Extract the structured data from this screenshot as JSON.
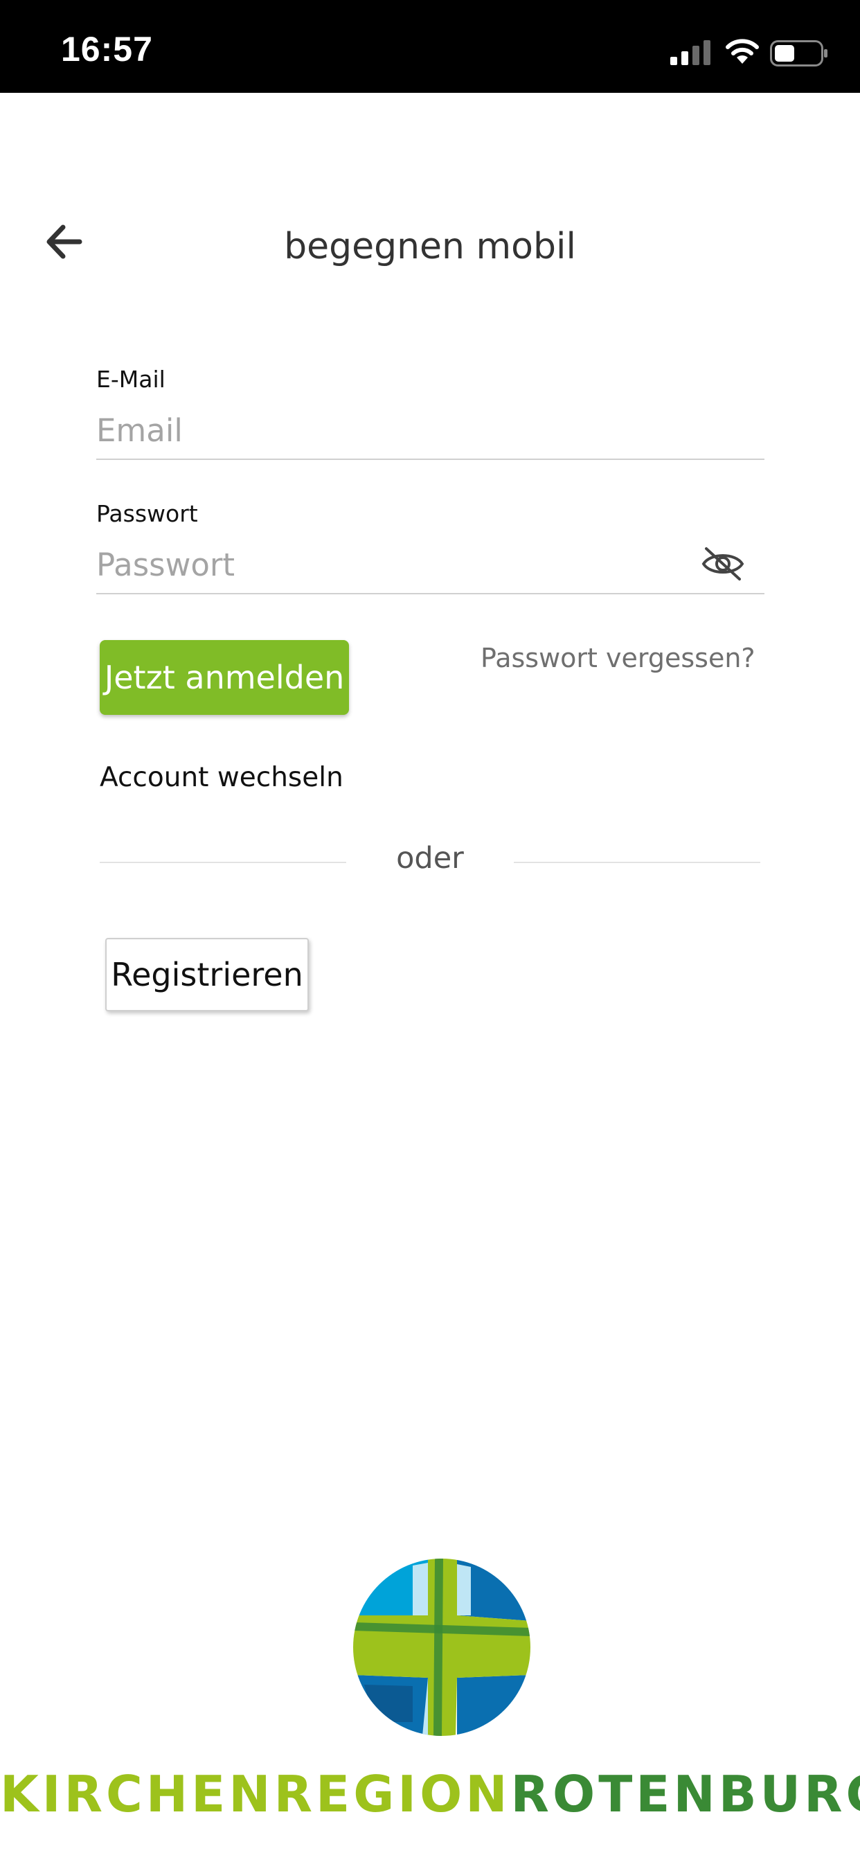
{
  "status_bar": {
    "time": "16:57",
    "icons": [
      "signal-icon",
      "wifi-icon",
      "battery-icon"
    ]
  },
  "header": {
    "back_icon": "arrow-left-icon",
    "title": "begegnen mobil"
  },
  "form": {
    "email": {
      "label": "E-Mail",
      "placeholder": "Email",
      "value": ""
    },
    "password": {
      "label": "Passwort",
      "placeholder": "Passwort",
      "value": "",
      "toggle_icon": "eye-off-icon"
    },
    "login_button": "Jetzt anmelden",
    "forgot_password": "Passwort vergessen?",
    "switch_account": "Account wechseln",
    "divider_text": "oder",
    "register_button": "Registrieren"
  },
  "logo": {
    "wordmark_part1": "KIRCHENREGION",
    "wordmark_part2": "ROTENBURG"
  },
  "colors": {
    "accent_green": "#80bc27",
    "logo_light_green": "#9dc21c",
    "logo_dark_green": "#3a8a35",
    "logo_blue": "#0a6fb0",
    "logo_light_blue": "#00a3d9"
  }
}
